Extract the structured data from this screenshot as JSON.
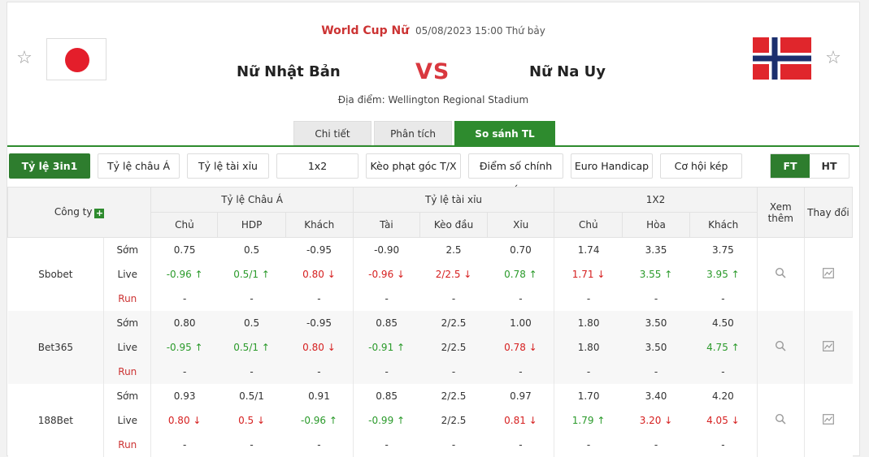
{
  "match": {
    "league": "World Cup Nữ",
    "datetime": "05/08/2023 15:00 Thứ bảy",
    "home": "Nữ Nhật Bản",
    "away": "Nữ Na Uy",
    "vs": "VS",
    "venue": "Địa điểm: Wellington Regional Stadium"
  },
  "icons": {
    "favorite": "star-icon",
    "search": "search-icon",
    "chart": "chart-icon",
    "add": "plus-icon"
  },
  "colors": {
    "accent": "#2e8b2e",
    "league": "#c33333",
    "up": "#2a9a2a",
    "down": "#d62020"
  },
  "tabs": [
    {
      "label": "Chi tiết"
    },
    {
      "label": "Phân tích"
    },
    {
      "label": "So sánh TL"
    }
  ],
  "filters": [
    {
      "label": "Tỷ lệ 3in1"
    },
    {
      "label": "Tỷ lệ châu Á"
    },
    {
      "label": "Tỷ lệ tài xỉu"
    },
    {
      "label": "1x2"
    },
    {
      "label": "Kèo phạt góc T/X"
    },
    {
      "label": "Điểm số chính xác"
    },
    {
      "label": "Euro Handicap"
    },
    {
      "label": "Cơ hội kép"
    }
  ],
  "period": {
    "ft": "FT",
    "ht": "HT"
  },
  "table": {
    "h_company": "Công ty",
    "h_asian": "Tỷ lệ Châu Á",
    "h_ou": "Tỷ lệ tài xỉu",
    "h_1x2": "1X2",
    "h_more": "Xem thêm",
    "h_change": "Thay đổi",
    "sub": [
      "Chủ",
      "HDP",
      "Khách",
      "Tài",
      "Kèo đầu",
      "Xỉu",
      "Chủ",
      "Hòa",
      "Khách"
    ],
    "rows": [
      {
        "company": "Sbobet",
        "lines": [
          {
            "state": "Sớm",
            "v": [
              "0.75",
              "0.5",
              "-0.95",
              "-0.90",
              "2.5",
              "0.70",
              "1.74",
              "3.35",
              "3.75"
            ],
            "t": [
              "",
              "",
              "",
              "",
              "",
              "",
              "",
              "",
              ""
            ]
          },
          {
            "state": "Live",
            "v": [
              "-0.96 ↑",
              "0.5/1 ↑",
              "0.80 ↓",
              "-0.96 ↓",
              "2/2.5 ↓",
              "0.78 ↑",
              "1.71 ↓",
              "3.55 ↑",
              "3.95 ↑"
            ],
            "t": [
              "up",
              "up",
              "down",
              "down",
              "down",
              "up",
              "down",
              "up",
              "up"
            ]
          },
          {
            "state": "Run",
            "v": [
              "-",
              "-",
              "-",
              "-",
              "-",
              "-",
              "-",
              "-",
              "-"
            ],
            "t": [
              "",
              "",
              "",
              "",
              "",
              "",
              "",
              "",
              ""
            ]
          }
        ]
      },
      {
        "company": "Bet365",
        "lines": [
          {
            "state": "Sớm",
            "v": [
              "0.80",
              "0.5",
              "-0.95",
              "0.85",
              "2/2.5",
              "1.00",
              "1.80",
              "3.50",
              "4.50"
            ],
            "t": [
              "",
              "",
              "",
              "",
              "",
              "",
              "",
              "",
              ""
            ]
          },
          {
            "state": "Live",
            "v": [
              "-0.95 ↑",
              "0.5/1 ↑",
              "0.80 ↓",
              "-0.91 ↑",
              "2/2.5",
              "0.78 ↓",
              "1.80",
              "3.50",
              "4.75 ↑"
            ],
            "t": [
              "up",
              "up",
              "down",
              "up",
              "",
              "down",
              "",
              "",
              "up"
            ]
          },
          {
            "state": "Run",
            "v": [
              "-",
              "-",
              "-",
              "-",
              "-",
              "-",
              "-",
              "-",
              "-"
            ],
            "t": [
              "",
              "",
              "",
              "",
              "",
              "",
              "",
              "",
              ""
            ]
          }
        ]
      },
      {
        "company": "188Bet",
        "lines": [
          {
            "state": "Sớm",
            "v": [
              "0.93",
              "0.5/1",
              "0.91",
              "0.85",
              "2/2.5",
              "0.97",
              "1.70",
              "3.40",
              "4.20"
            ],
            "t": [
              "",
              "",
              "",
              "",
              "",
              "",
              "",
              "",
              ""
            ]
          },
          {
            "state": "Live",
            "v": [
              "0.80 ↓",
              "0.5 ↓",
              "-0.96 ↑",
              "-0.99 ↑",
              "2/2.5",
              "0.81 ↓",
              "1.79 ↑",
              "3.20 ↓",
              "4.05 ↓"
            ],
            "t": [
              "down",
              "down",
              "up",
              "up",
              "",
              "down",
              "up",
              "down",
              "down"
            ]
          },
          {
            "state": "Run",
            "v": [
              "-",
              "-",
              "-",
              "-",
              "-",
              "-",
              "-",
              "-",
              "-"
            ],
            "t": [
              "",
              "",
              "",
              "",
              "",
              "",
              "",
              "",
              ""
            ]
          }
        ]
      }
    ]
  }
}
